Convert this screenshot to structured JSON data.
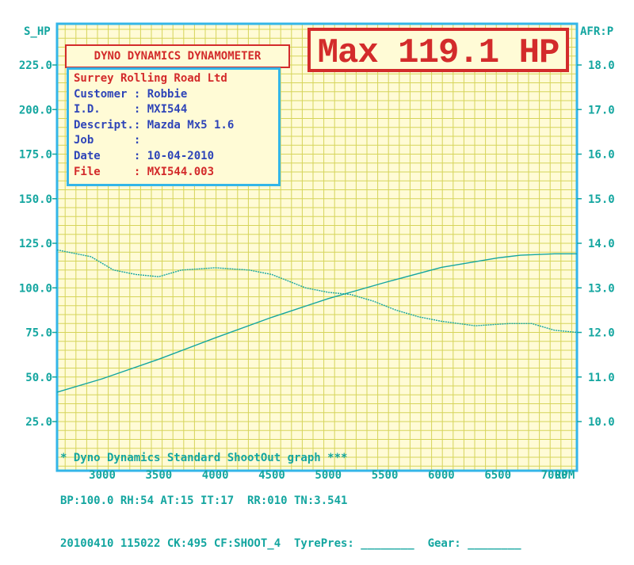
{
  "header": {
    "title": "DYNO DYNAMICS DYNAMOMETER",
    "max_label": "Max 119.1 HP"
  },
  "info": {
    "company": "Surrey Rolling Road Ltd",
    "customer": "Customer : Robbie",
    "id": "I.D.     : MXI544",
    "descript": "Descript.: Mazda Mx5 1.6",
    "job": "Job      :",
    "date": "Date     : 10-04-2010",
    "file": "File     : MXI544.003"
  },
  "footer": {
    "line1": "* Dyno Dynamics Standard ShootOut graph ***",
    "line2": "BP:100.0 RH:54 AT:15 IT:17  RR:010 TN:3.541",
    "line3": "20100410 115022 CK:495 CF:SHOOT_4  TyrePres: ________  Gear: ________"
  },
  "colors": {
    "background": "#fffbd6",
    "grid": "#d6d45a",
    "frame": "#33b6e8",
    "axis_text": "#14a6a0",
    "curve": "#14a6a0",
    "title_red": "#d32b2b",
    "info_blue": "#2f45b8"
  },
  "chart_data": {
    "type": "line",
    "x_label": "RPM",
    "y_left_label": "S_HP",
    "y_right_label": "AFR:P",
    "xlim": [
      2600,
      7200
    ],
    "ylim_left": [
      25,
      250
    ],
    "ylim_right": [
      10,
      19
    ],
    "x_ticks": [
      3000,
      3500,
      4000,
      4500,
      5000,
      5500,
      6000,
      6500,
      7000
    ],
    "x_tick_labels": [
      "3000",
      "3500",
      "4000",
      "4500",
      "5000",
      "5500",
      "6000",
      "6500",
      "7000"
    ],
    "y_left_ticks": [
      25,
      50,
      75,
      100,
      125,
      150,
      175,
      200,
      225
    ],
    "y_left_tick_labels": [
      "25.0",
      "50.0",
      "75.0",
      "100.0",
      "125.0",
      "150.0",
      "175.0",
      "200.0",
      "225.0"
    ],
    "y_right_ticks": [
      10,
      11,
      12,
      13,
      14,
      15,
      16,
      17,
      18
    ],
    "y_right_tick_labels": [
      "10.0",
      "11.0",
      "12.0",
      "13.0",
      "14.0",
      "15.0",
      "16.0",
      "17.0",
      "18.0"
    ],
    "grid": true,
    "series": [
      {
        "axis": "left",
        "x": [
          2600,
          3000,
          3500,
          4000,
          4500,
          5000,
          5500,
          6000,
          6500,
          6700,
          7000,
          7200
        ],
        "values": [
          41.5,
          49,
          60,
          72,
          83.5,
          94,
          103,
          111.5,
          116.8,
          118.3,
          119.1,
          119.1
        ]
      },
      {
        "axis": "right",
        "x": [
          2600,
          2900,
          3100,
          3300,
          3500,
          3700,
          4000,
          4300,
          4500,
          4800,
          5000,
          5200,
          5400,
          5600,
          5800,
          6000,
          6300,
          6600,
          6800,
          7000,
          7200
        ],
        "values": [
          13.85,
          13.7,
          13.4,
          13.3,
          13.25,
          13.4,
          13.45,
          13.4,
          13.3,
          13.0,
          12.9,
          12.85,
          12.7,
          12.5,
          12.35,
          12.25,
          12.15,
          12.2,
          12.2,
          12.05,
          12.0
        ]
      }
    ]
  }
}
